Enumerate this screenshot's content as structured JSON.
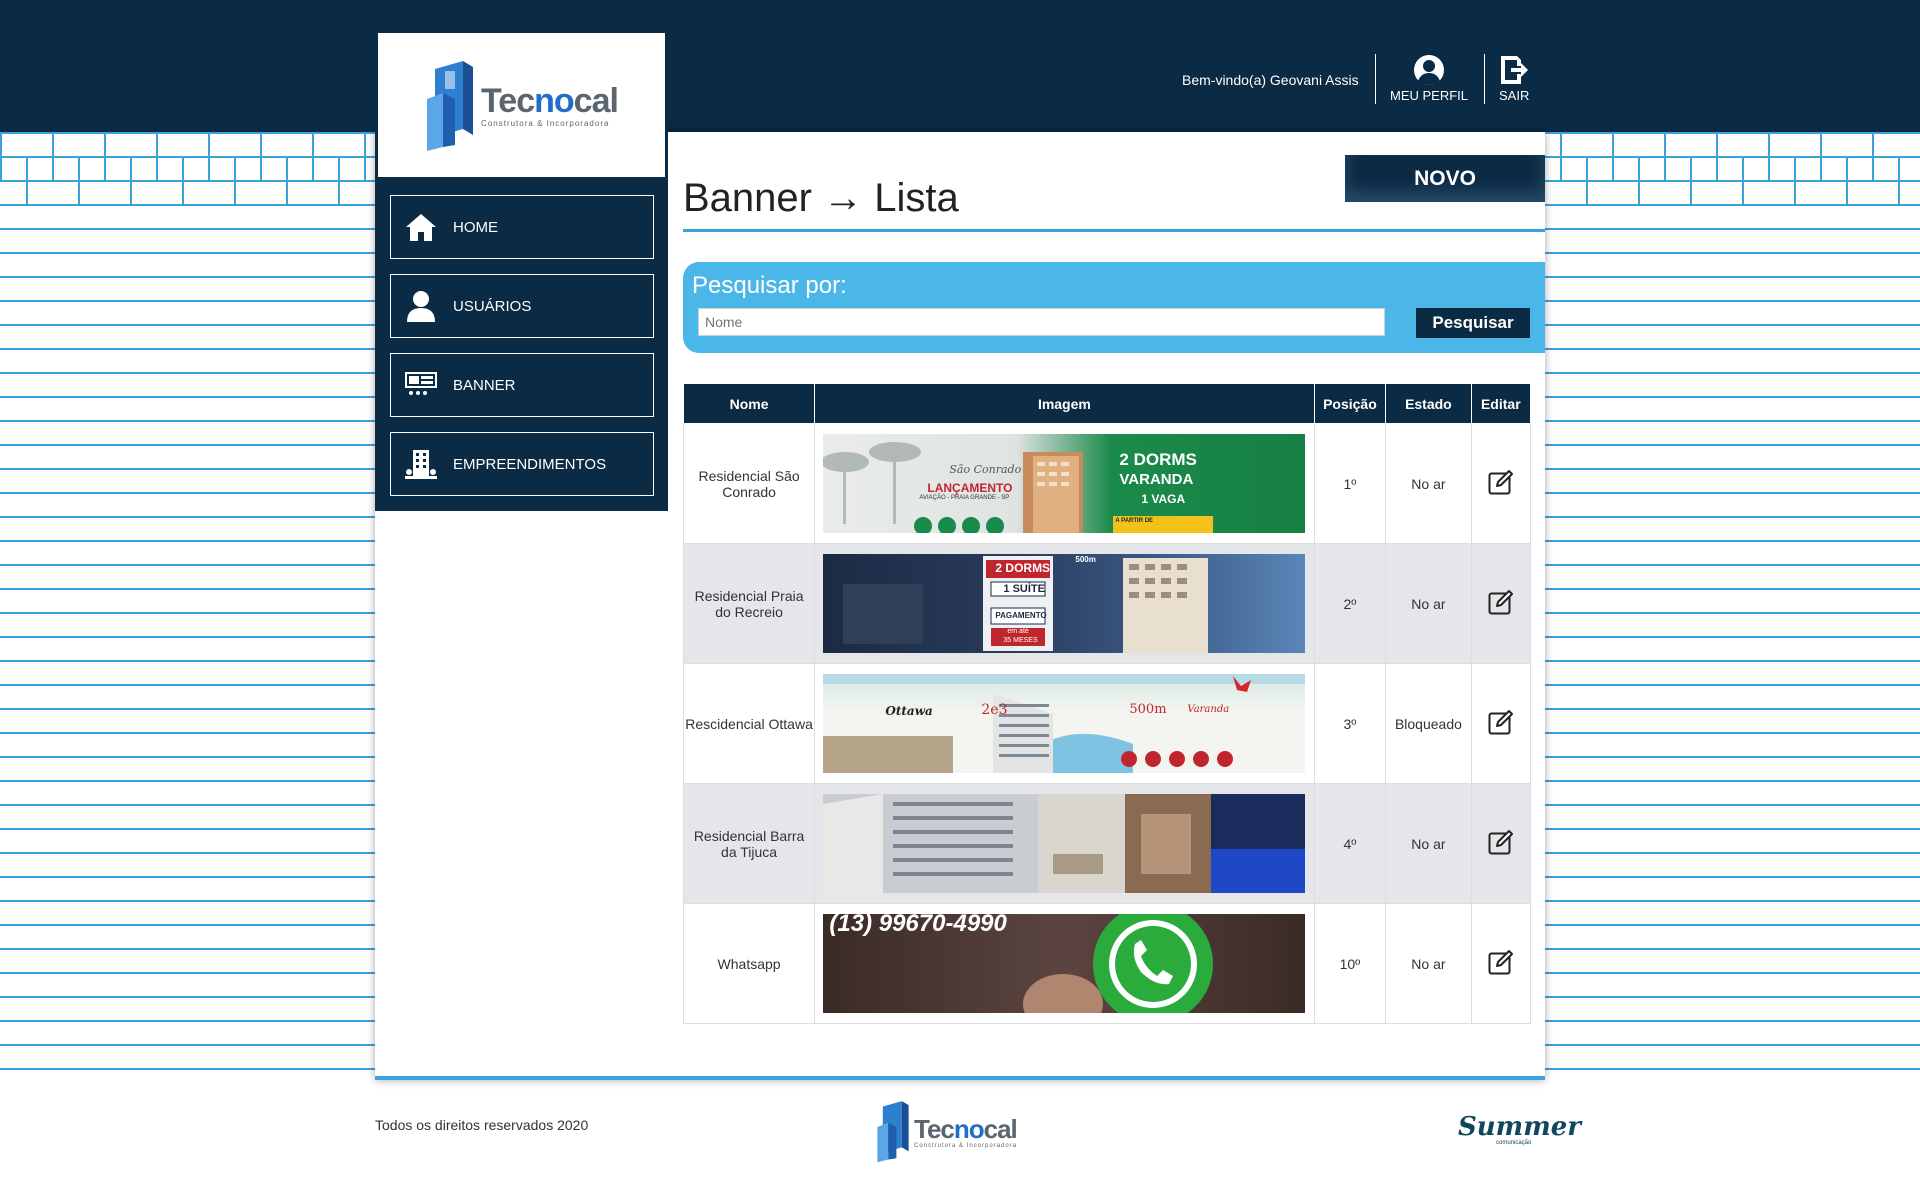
{
  "header": {
    "welcome": "Bem-vindo(a) Geovani Assis",
    "profile_label": "MEU PERFIL",
    "logout_label": "SAIR"
  },
  "brand": {
    "word_pre": "Tec",
    "word_hl": "no",
    "word_post": "cal",
    "tagline": "Construtora & Incorporadora"
  },
  "sidebar": {
    "items": [
      {
        "label": "HOME",
        "icon": "home-icon"
      },
      {
        "label": "USUÁRIOS",
        "icon": "user-icon"
      },
      {
        "label": "BANNER",
        "icon": "banner-icon"
      },
      {
        "label": "EMPREENDIMENTOS",
        "icon": "building-icon"
      }
    ]
  },
  "page": {
    "title": "Banner → Lista",
    "new_button": "NOVO"
  },
  "search": {
    "label": "Pesquisar por:",
    "placeholder": "Nome",
    "value": "",
    "button": "Pesquisar"
  },
  "table": {
    "headers": [
      "Nome",
      "Imagem",
      "Posição",
      "Estado",
      "Editar"
    ],
    "rows": [
      {
        "nome": "Residencial São Conrado",
        "posicao": "1º",
        "estado": "No ar",
        "img": {
          "t1": "São Conrado",
          "t2": "LANÇAMENTO",
          "t3": "AVIAÇÃO - PRAIA GRANDE - SP",
          "t4": "2 DORMS",
          "t5": "VARANDA",
          "t6": "1 VAGA",
          "t7": "A PARTIR DE"
        }
      },
      {
        "nome": "Residencial Praia do Recreio",
        "posicao": "2º",
        "estado": "No ar",
        "img": {
          "t1": "2 DORMS",
          "t2": "1 SUÍTE",
          "t3": "PAGAMENTO",
          "t4": "em até",
          "t5": "35 MESES",
          "t6": "500m"
        }
      },
      {
        "nome": "Rescidencial Ottawa",
        "posicao": "3º",
        "estado": "Bloqueado",
        "img": {
          "t1": "Ottawa",
          "t2": "2e3",
          "t3": "500m",
          "t4": "Varanda"
        }
      },
      {
        "nome": "Residencial Barra da Tijuca",
        "posicao": "4º",
        "estado": "No ar",
        "img": {}
      },
      {
        "nome": "Whatsapp",
        "posicao": "10º",
        "estado": "No ar",
        "img": {
          "t1": "(13) 99670-4990"
        }
      }
    ]
  },
  "footer": {
    "copyright": "Todos os direitos reservados 2020",
    "agency": "Summer",
    "agency_sub": "comunicação"
  },
  "colors": {
    "navy": "#0b2a43",
    "accent": "#3aa3dc",
    "search_bg": "#4bb6e8"
  }
}
